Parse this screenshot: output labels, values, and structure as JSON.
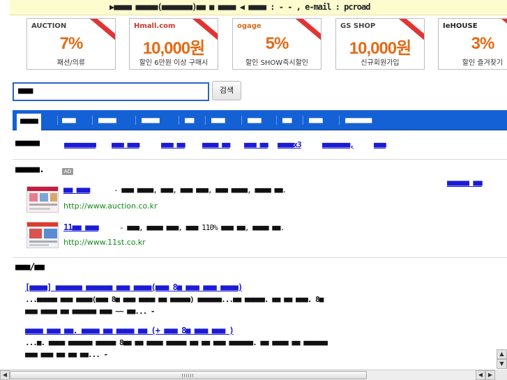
{
  "top_banner": {
    "text": "▶■■■■ ■■■■■(■■■■■■■)■■ ■ ■■■■ ◀ ■■■■ :   -   -   , e-mail : pcroad"
  },
  "ad_banners": [
    {
      "brand": "AUCTION",
      "value": "7%",
      "caption": "패션/의류"
    },
    {
      "brand": "Hmall.com",
      "value": "10,000원",
      "caption": "할인 6만원 이상 구매시"
    },
    {
      "brand": "ogage",
      "value": "5%",
      "caption": "할인 SHOW즉시할인"
    },
    {
      "brand": "GS SHOP",
      "value": "10,000원",
      "caption": "신규회원가입"
    },
    {
      "brand": "IeHOUSE",
      "value": "3%",
      "caption": "할인 즐겨찾기"
    }
  ],
  "search": {
    "value": "■■■",
    "button_label": "검색"
  },
  "nav_tabs": [
    {
      "label": "■■■■"
    },
    {
      "label": "■■■"
    },
    {
      "label": "■■■■"
    },
    {
      "label": "■■■■"
    },
    {
      "label": "■■"
    },
    {
      "label": "■■■"
    },
    {
      "label": "■■■"
    },
    {
      "label": "■■"
    },
    {
      "label": "■■■"
    },
    {
      "label": "■■■■■■"
    }
  ],
  "related": {
    "label": "■■■■■",
    "links": [
      "■■■■■■■■",
      "■■■ ■■■",
      "■■■ ■■",
      "■■■■ ■■",
      "■■■ ■■",
      "■■■■x3",
      "■■■■■■■,",
      "■■■"
    ]
  },
  "sponsored": {
    "label": "■■■■■.",
    "badge": "AD",
    "more_link": "■■■■■ ■■",
    "items": [
      {
        "title": "■■ ■■■",
        "desc": "- ■■■ ■■■■, ■■■, ■■■ ■■■, ■■■ ■■■■, ■■■■ ■■.",
        "url": "http://www.auction.co.kr"
      },
      {
        "title": "11■■ ■■■",
        "desc": "- ■■■, ■■■■ ■■■, ■■■ 110% ■■■ ■■, ■■■■ ■■.",
        "url": "http://www.11st.co.kr"
      }
    ]
  },
  "news": {
    "label": "■■■/■■",
    "items": [
      {
        "title": "[■■■■] ■■■■■■ ■■■■■■ ■■■ ■■■■(■■■ 8■ ■■■ ■■■ ■■■■)",
        "desc_line1": "...■■■■■ ■■■ ■■■■(■■■ 8■ ■■■ ■■■■ ■■ ■■■■■) ■■■■■■...■■ ■■■■■. ■■ ■■ ■■■. 8■",
        "desc_line2": "■■■ ■■■■ ■■ ■■■■■■ ■■■ ~~ ■■... -"
      },
      {
        "title": "■■■■ ■■■ ■■. ■■■■ ■■ ■■■■ ■■ (+ ■■■ 8■ ■■■ ■■■ )",
        "desc_line1": "...■. ■■■■ ■■■■■■ ■■■■■ 8■■ ■■ ■■■■ ■■■■■ ■■ ■■ ■■■ ■■■■■■. ■■ ■■■■ ■■ ■■■■■■",
        "desc_line2": "■■■ ■■■ ■■ ■■ ■■... -"
      }
    ]
  }
}
